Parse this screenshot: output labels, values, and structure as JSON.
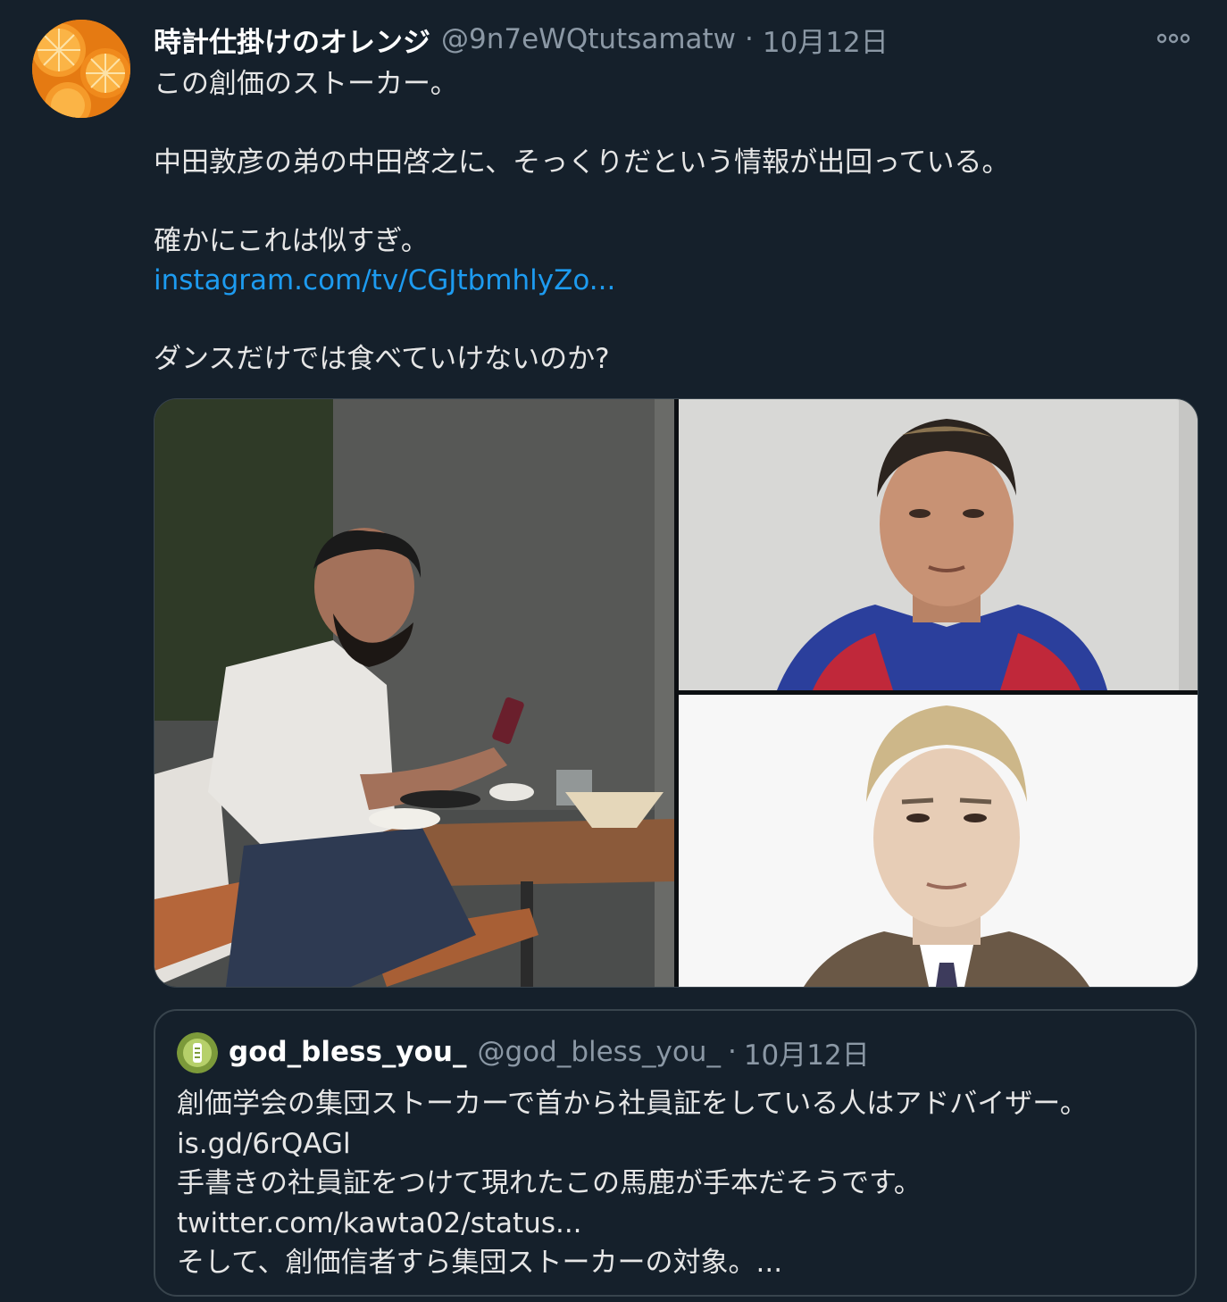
{
  "tweet": {
    "author": {
      "display_name": "時計仕掛けのオレンジ",
      "handle": "@9n7eWQtutsamatw",
      "avatar_icon": "orange-slices-avatar"
    },
    "separator": "·",
    "date": "10月12日",
    "more_icon": "more-options-icon",
    "text": {
      "line1": "この創価のストーカー。",
      "line2": "中田敦彦の弟の中田啓之に、そっくりだという情報が出回っている。",
      "line3": "確かにこれは似すぎ。",
      "link": "instagram.com/tv/CGJtbmhlyZo...",
      "line4": "ダンスだけでは食べていけないのか?"
    },
    "media": [
      {
        "name": "photo-man-with-phone-at-cafe"
      },
      {
        "name": "photo-man-portrait-blue-jacket"
      },
      {
        "name": "photo-man-portrait-blonde"
      }
    ]
  },
  "quote": {
    "author": {
      "display_name": "god_bless_you_",
      "handle": "@god_bless_you_",
      "avatar_icon": "green-circle-avatar"
    },
    "separator": "·",
    "date": "10月12日",
    "text": {
      "line1": "創価学会の集団ストーカーで首から社員証をしている人はアドバイザー。",
      "link1": "is.gd/6rQAGl",
      "line2": "手書きの社員証をつけて現れたこの馬鹿が手本だそうです。",
      "link2": "twitter.com/kawta02/status...",
      "line3": "そして、創価信者すら集団ストーカーの対象。..."
    }
  },
  "colors": {
    "background": "#15202b",
    "text": "#e6e6e6",
    "secondary": "#8b98a5",
    "link": "#1d9bf0",
    "border": "#38444d"
  }
}
